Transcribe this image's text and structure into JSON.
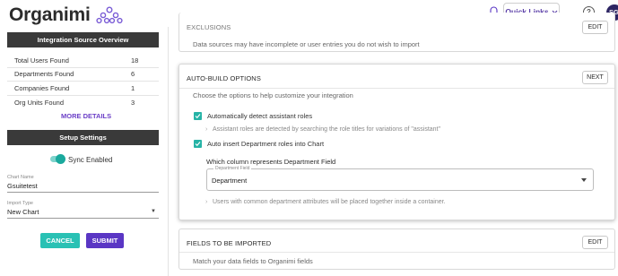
{
  "header": {
    "logo_text": "Organimi",
    "quick_links_label": "Quick Links",
    "help_label": "?",
    "avatar_initials": "SG"
  },
  "left_panel": {
    "overview_title": "Integration Source Overview",
    "stats": [
      {
        "label": "Total Users Found",
        "value": "18"
      },
      {
        "label": "Departments Found",
        "value": "6"
      },
      {
        "label": "Companies Found",
        "value": "1"
      },
      {
        "label": "Org Units Found",
        "value": "3"
      }
    ],
    "more_details_label": "MORE DETAILS",
    "setup_title": "Setup Settings",
    "sync_label": "Sync Enabled",
    "sync_enabled": true,
    "chart_name_label": "Chart Name",
    "chart_name_value": "Gsuitetest",
    "import_type_label": "Import Type",
    "import_type_value": "New Chart",
    "cancel_label": "CANCEL",
    "submit_label": "SUBMIT"
  },
  "exclusions": {
    "title": "EXCLUSIONS",
    "button_label": "EDIT",
    "description": "Data sources may have incomplete or user entries you do not wish to import"
  },
  "auto_build": {
    "title": "AUTO-BUILD OPTIONS",
    "button_label": "NEXT",
    "description": "Choose the options to help customize your integration",
    "option1_label": "Automatically detect assistant roles",
    "option1_checked": true,
    "option1_hint": "Assistant roles are detected by searching the role titles for variations of \"assistant\"",
    "option2_label": "Auto insert Department roles into Chart",
    "option2_checked": true,
    "column_question": "Which column represents Department Field",
    "select_legend": "Department Field",
    "select_value": "Department",
    "department_hint": "Users with common department attributes will be placed together inside a container."
  },
  "fields_import": {
    "title": "FIELDS TO BE IMPORTED",
    "button_label": "EDIT",
    "description": "Match your data fields to Organimi fields"
  },
  "colors": {
    "accent_purple": "#5a36c4",
    "accent_teal": "#29c1b4",
    "panel_header": "#3a3a3a",
    "avatar": "#2d2563"
  }
}
